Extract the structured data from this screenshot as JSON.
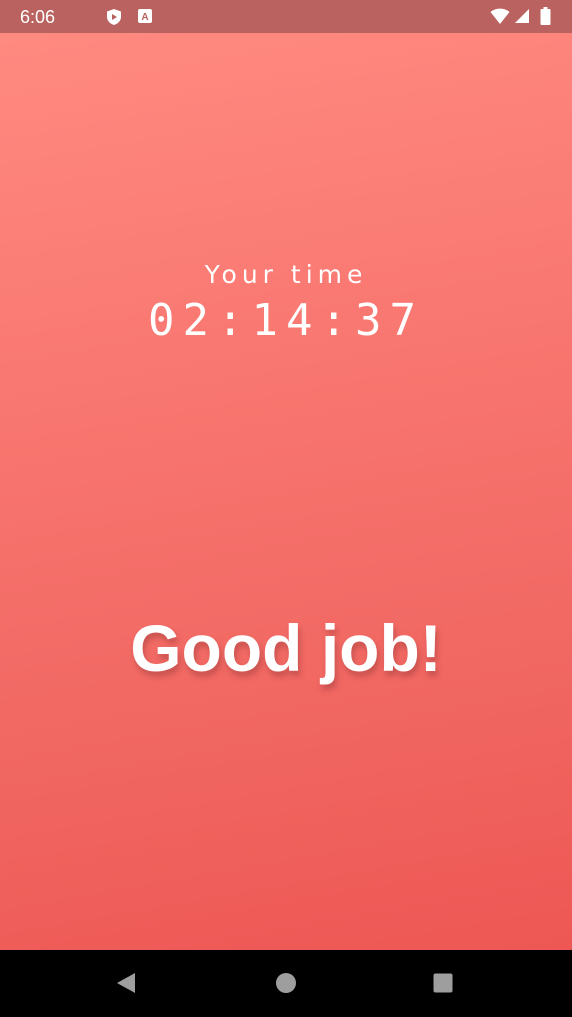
{
  "status_bar": {
    "time": "6:06",
    "icons": [
      "play-protect-icon",
      "keyboard-icon",
      "wifi-icon",
      "signal-icon",
      "battery-icon"
    ]
  },
  "main": {
    "label": "Your time",
    "timer": "02:14:37",
    "message": "Good job!"
  },
  "nav_bar": {
    "buttons": [
      "back-button",
      "home-button",
      "recents-button"
    ]
  },
  "colors": {
    "status_bar_bg": "#b9625f",
    "gradient_top": "#ff8a80",
    "gradient_bottom": "#ee5754",
    "text": "#ffffff",
    "nav_bar_bg": "#000000",
    "nav_icon": "#9e9e9e"
  }
}
